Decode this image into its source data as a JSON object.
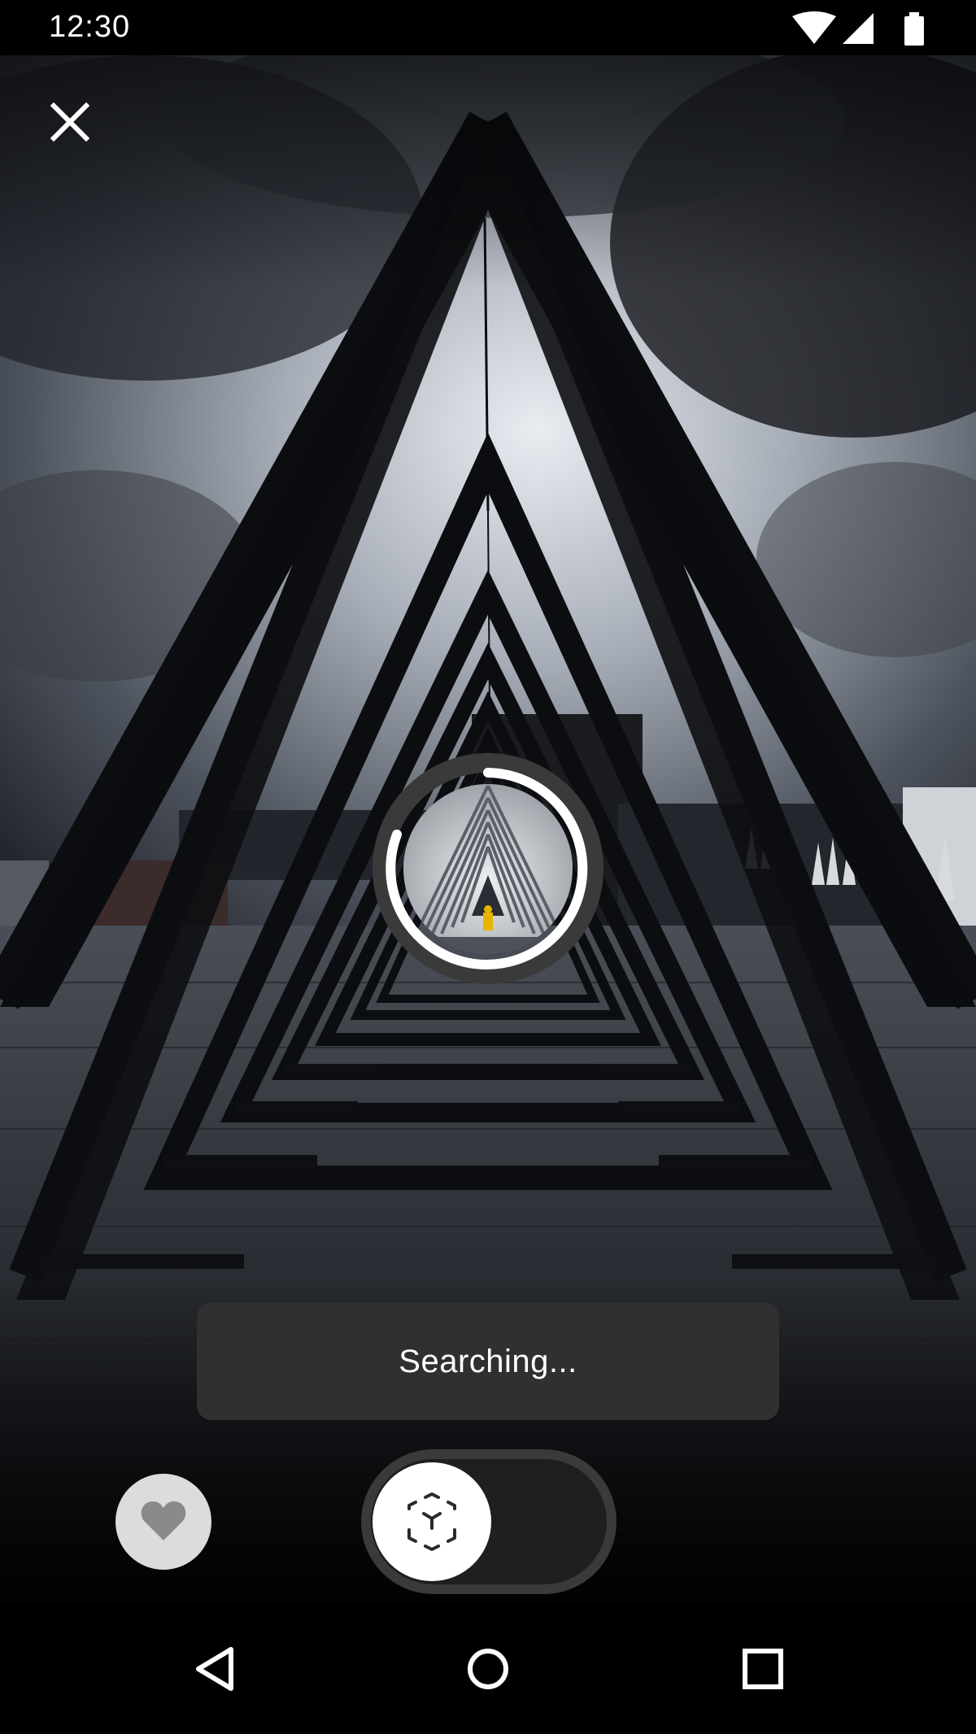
{
  "status_bar": {
    "time": "12:30",
    "icons": [
      "wifi-icon",
      "cellular-signal-icon",
      "battery-icon"
    ]
  },
  "toolbar": {
    "close_icon": "close-icon"
  },
  "scanner": {
    "state": "searching",
    "progress_arc_color": "#ffffff",
    "track_color": "#3a3a3a"
  },
  "toast": {
    "message": "Searching..."
  },
  "controls": {
    "favorite_icon": "heart-icon",
    "mode_toggle_icon": "ar-cube-icon",
    "mode_toggle_on": false
  },
  "nav_bar": {
    "back_icon": "back-triangle-icon",
    "home_icon": "home-circle-icon",
    "recents_icon": "recents-square-icon"
  },
  "colors": {
    "toast_bg": "#303030",
    "favorite_bg": "#dcdcdc",
    "heart": "#8a8a8a",
    "toggle_bg": "#1f1f1f",
    "toggle_border": "#3a3a3a"
  }
}
